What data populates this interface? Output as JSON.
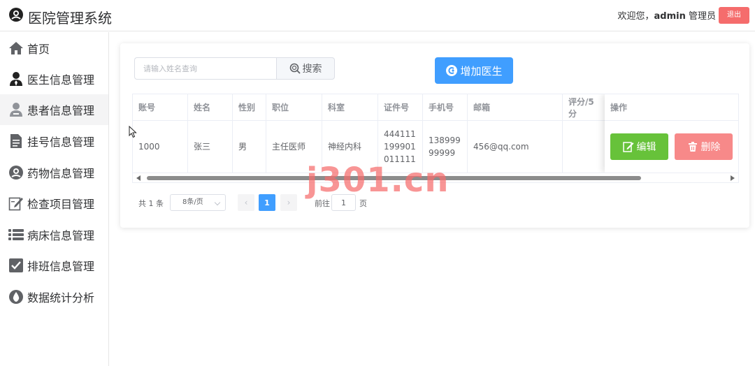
{
  "header": {
    "app_title": "医院管理系统",
    "welcome_prefix": "欢迎您，",
    "username": "admin",
    "role": "管理员",
    "logout_label": "退出"
  },
  "sidebar": {
    "items": [
      {
        "label": "首页",
        "icon": "home-icon"
      },
      {
        "label": "医生信息管理",
        "icon": "doctor-icon"
      },
      {
        "label": "患者信息管理",
        "icon": "patient-icon"
      },
      {
        "label": "挂号信息管理",
        "icon": "document-icon"
      },
      {
        "label": "药物信息管理",
        "icon": "medicine-icon"
      },
      {
        "label": "检查项目管理",
        "icon": "edit-form-icon"
      },
      {
        "label": "病床信息管理",
        "icon": "list-icon"
      },
      {
        "label": "排班信息管理",
        "icon": "checkbox-icon"
      },
      {
        "label": "数据统计分析",
        "icon": "drop-icon"
      }
    ]
  },
  "toolbar": {
    "search_placeholder": "请输入姓名查询",
    "search_label": "搜索",
    "add_label": "增加医生"
  },
  "table": {
    "columns": [
      "账号",
      "姓名",
      "性别",
      "职位",
      "科室",
      "证件号",
      "手机号",
      "邮箱",
      "评分/5分",
      "操作"
    ],
    "rows": [
      {
        "account": "1000",
        "name": "张三",
        "gender": "男",
        "title": "主任医师",
        "department": "神经内科",
        "id_number": "444111199901011111",
        "phone": "13899999999",
        "email": "456@qq.com",
        "rating": "",
        "edit_label": "编辑",
        "delete_label": "删除"
      }
    ]
  },
  "pagination": {
    "total_text": "共 1 条",
    "page_size": "8条/页",
    "current_page": "1",
    "goto_label": "前往",
    "goto_value": "1",
    "page_suffix": "页"
  },
  "watermark": "j301.cn",
  "colors": {
    "primary": "#409eff",
    "success": "#67c23a",
    "danger": "#f78989",
    "logout": "#f56c6c"
  }
}
